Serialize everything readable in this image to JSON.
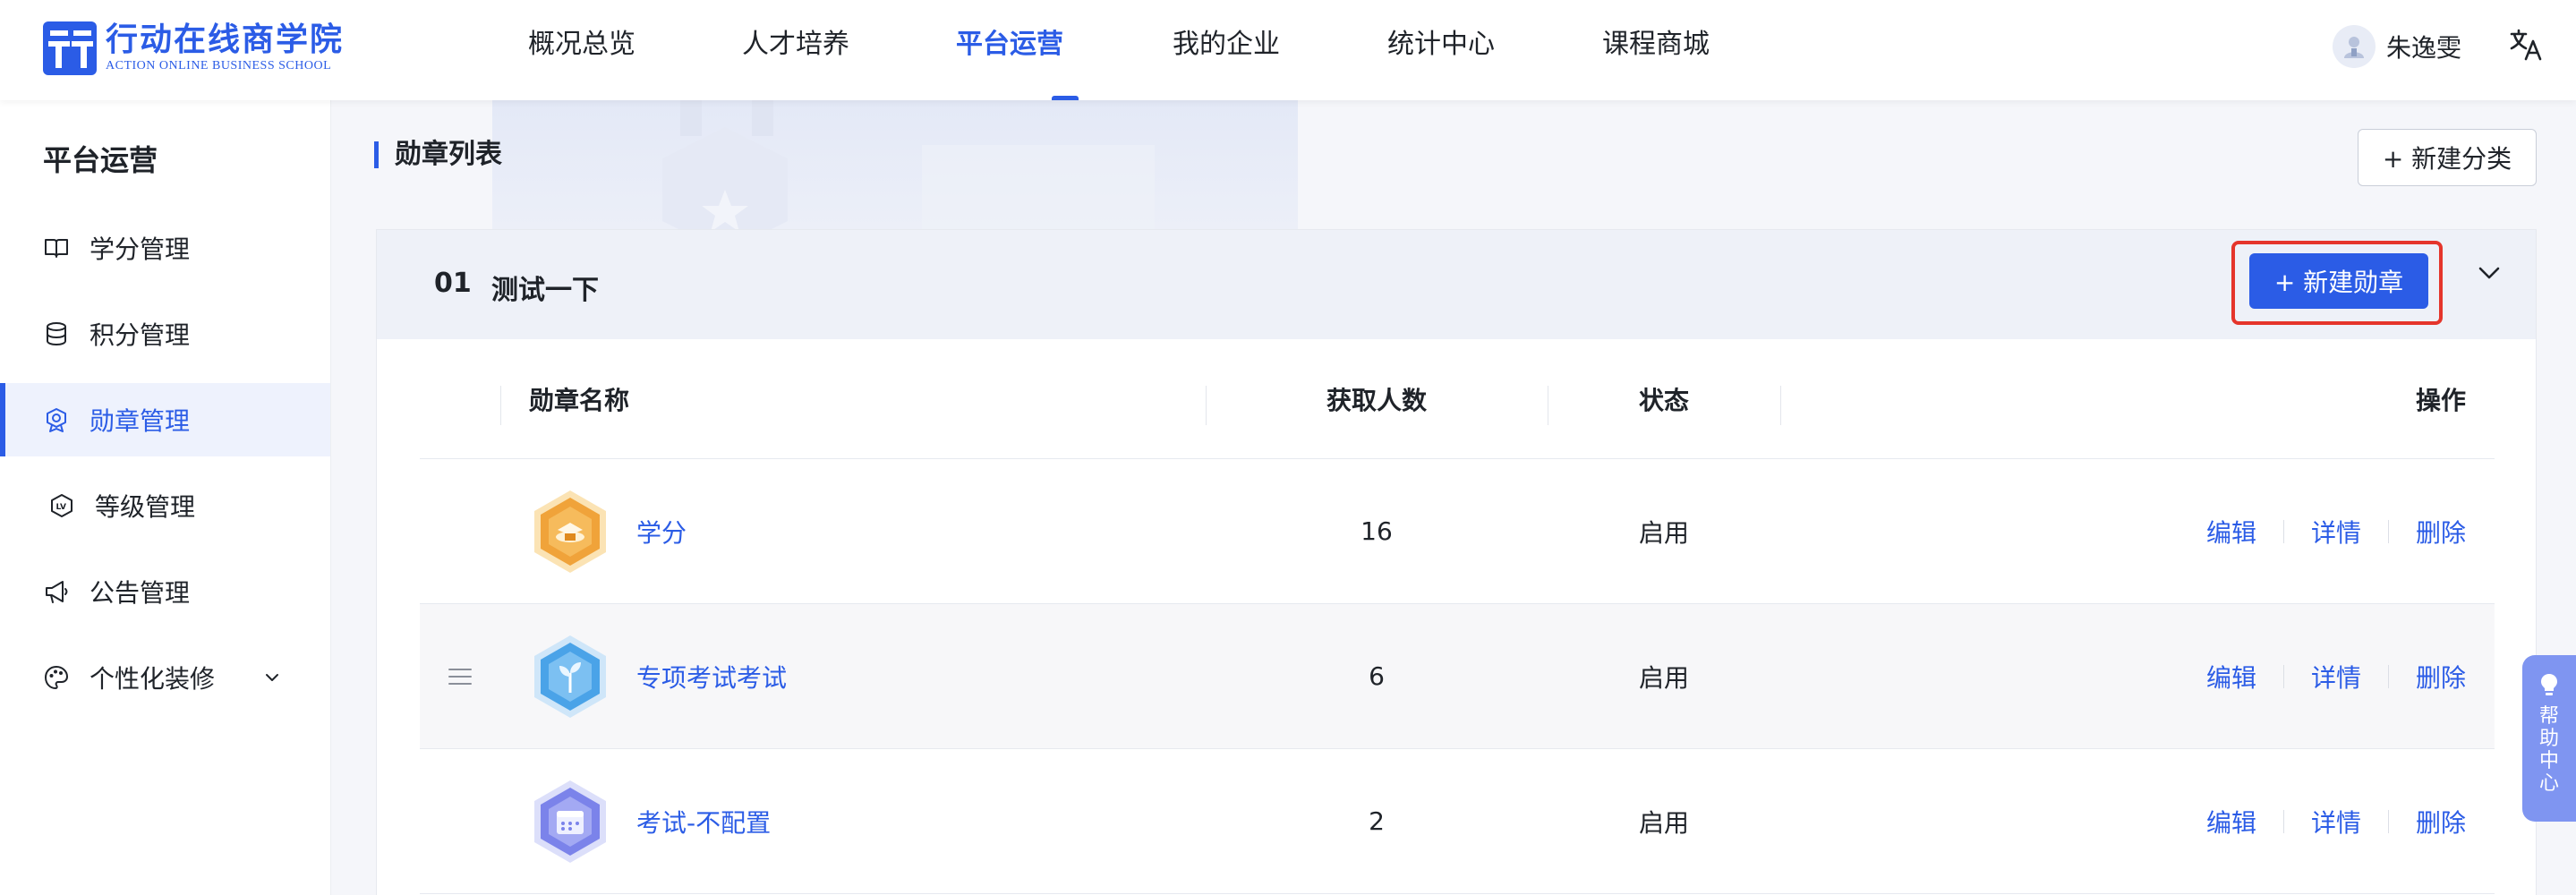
{
  "brand": {
    "name_cn": "行动在线商学院",
    "name_en": "ACTION ONLINE BUSINESS SCHOOL",
    "accent": "#2b5ce6"
  },
  "nav": {
    "items": [
      {
        "label": "概况总览"
      },
      {
        "label": "人才培养"
      },
      {
        "label": "平台运营"
      },
      {
        "label": "我的企业"
      },
      {
        "label": "统计中心"
      },
      {
        "label": "课程商城"
      }
    ],
    "active": "平台运营"
  },
  "user": {
    "name": "朱逸雯",
    "avatar_icon": "user-avatar-icon",
    "lang_icon": "translate-icon"
  },
  "sidebar": {
    "title": "平台运营",
    "items": [
      {
        "label": "学分管理",
        "icon": "book-icon"
      },
      {
        "label": "积分管理",
        "icon": "database-icon"
      },
      {
        "label": "勋章管理",
        "icon": "medal-icon"
      },
      {
        "label": "等级管理",
        "icon": "level-icon"
      },
      {
        "label": "公告管理",
        "icon": "megaphone-icon"
      },
      {
        "label": "个性化装修",
        "icon": "palette-icon"
      }
    ]
  },
  "main": {
    "section_title": "勋章列表",
    "new_category_label": "+ 新建分类",
    "category": {
      "index": "01",
      "name": "测试一下",
      "new_badge_label": "+ 新建勋章"
    },
    "table": {
      "columns": [
        "勋章名称",
        "获取人数",
        "状态",
        "操作"
      ],
      "rows": [
        {
          "name": "学分",
          "count": "16",
          "status": "启用",
          "badge_color": "#f0a33a"
        },
        {
          "name": "专项考试考试",
          "count": "6",
          "status": "启用",
          "badge_color": "#4aa3e8"
        },
        {
          "name": "考试-不配置",
          "count": "2",
          "status": "启用",
          "badge_color": "#7b83ea"
        }
      ],
      "actions": {
        "edit": "编辑",
        "detail": "详情",
        "delete": "删除"
      }
    }
  },
  "help": {
    "label": "帮助中心"
  }
}
